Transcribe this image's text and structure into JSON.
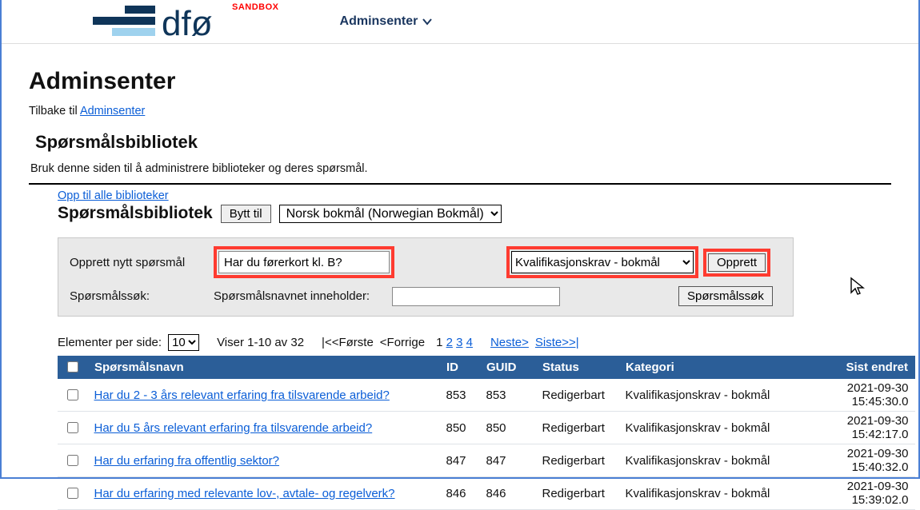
{
  "brand": {
    "sandbox": "SANDBOX"
  },
  "nav": {
    "adminsenter": "Adminsenter"
  },
  "page_title": "Adminsenter",
  "crumb": {
    "prefix": "Tilbake til ",
    "link": "Adminsenter"
  },
  "subtitle": "Spørsmålsbibliotek",
  "description": "Bruk denne siden til å administrere biblioteker og deres spørsmål.",
  "all_libs_link": "Opp til alle biblioteker",
  "lib_title": "Spørsmålsbibliotek",
  "switch_btn": "Bytt til",
  "lang_value": "Norsk bokmål (Norwegian Bokmål)",
  "create": {
    "label": "Opprett nytt spørsmål",
    "input_value": "Har du førerkort kl. B?",
    "category_value": "Kvalifikasjonskrav - bokmål",
    "button": "Opprett"
  },
  "search": {
    "label": "Spørsmålssøk:",
    "contains_label": "Spørsmålsnavnet inneholder:",
    "button": "Spørsmålssøk"
  },
  "paging": {
    "per_page_label": "Elementer per side:",
    "per_page_value": "10",
    "showing": "Viser 1-10 av 32",
    "first": "|<<Første",
    "prev": "<Forrige",
    "pages": [
      "1",
      "2",
      "3",
      "4"
    ],
    "next": "Neste>",
    "last": "Siste>>|"
  },
  "table": {
    "headers": {
      "name": "Spørsmålsnavn",
      "id": "ID",
      "guid": "GUID",
      "status": "Status",
      "category": "Kategori",
      "modified": "Sist endret"
    },
    "rows": [
      {
        "name": "Har du 2 - 3 års relevant erfaring fra tilsvarende arbeid?",
        "id": "853",
        "guid": "853",
        "status": "Redigerbart",
        "category": "Kvalifikasjonskrav - bokmål",
        "modified": "2021-09-30 15:45:30.0"
      },
      {
        "name": "Har du 5 års relevant erfaring fra tilsvarende arbeid?",
        "id": "850",
        "guid": "850",
        "status": "Redigerbart",
        "category": "Kvalifikasjonskrav - bokmål",
        "modified": "2021-09-30 15:42:17.0"
      },
      {
        "name": "Har du erfaring fra offentlig sektor?",
        "id": "847",
        "guid": "847",
        "status": "Redigerbart",
        "category": "Kvalifikasjonskrav - bokmål",
        "modified": "2021-09-30 15:40:32.0"
      },
      {
        "name": "Har du erfaring med relevante lov-, avtale- og regelverk?",
        "id": "846",
        "guid": "846",
        "status": "Redigerbart",
        "category": "Kvalifikasjonskrav - bokmål",
        "modified": "2021-09-30 15:39:02.0"
      }
    ]
  }
}
